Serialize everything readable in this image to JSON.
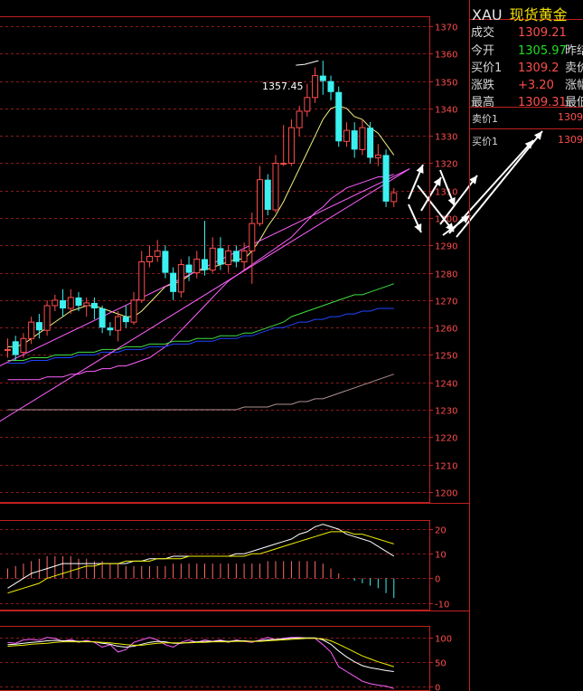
{
  "quote": {
    "symbol": "XAU",
    "name": "现货黄金",
    "rows": [
      {
        "label": "成交",
        "value": "1309.21",
        "value_color": "#ff4d4d",
        "label2": ""
      },
      {
        "label": "今开",
        "value": "1305.97",
        "value_color": "#22dd22",
        "label2": "昨结"
      },
      {
        "label": "买价1",
        "value": "1309.2",
        "value_color": "#ff4d4d",
        "label2": "卖价"
      },
      {
        "label": "涨跌",
        "value": "+3.20",
        "value_color": "#ff4d4d",
        "label2": "涨幅"
      },
      {
        "label": "最高",
        "value": "1309.31",
        "value_color": "#ff4d4d",
        "label2": "最低"
      }
    ],
    "order_book": [
      {
        "label": "卖价1",
        "value": "1309"
      },
      {
        "label": "买价1",
        "value": "1309"
      }
    ]
  },
  "chart_data": [
    {
      "type": "candlestick",
      "title": "",
      "y_ticks": [
        1200,
        1210,
        1220,
        1230,
        1240,
        1250,
        1260,
        1270,
        1280,
        1290,
        1300,
        1310,
        1320,
        1330,
        1340,
        1350,
        1360,
        1370
      ],
      "ylim": [
        1196,
        1373
      ],
      "annotation": {
        "text": "1357.45",
        "index": 40,
        "value": 1357.45
      },
      "colors": {
        "up": "#ff4d4d",
        "down": "#3cf0f0"
      },
      "candles": [
        [
          1252,
          1252,
          1256,
          1249
        ],
        [
          1255,
          1250,
          1257,
          1248
        ],
        [
          1251,
          1256,
          1258,
          1249
        ],
        [
          1256,
          1262,
          1264,
          1254
        ],
        [
          1262,
          1259,
          1265,
          1256
        ],
        [
          1259,
          1268,
          1270,
          1257
        ],
        [
          1268,
          1270,
          1272,
          1266
        ],
        [
          1270,
          1267,
          1274,
          1264
        ],
        [
          1267,
          1271,
          1274,
          1265
        ],
        [
          1271,
          1268,
          1273,
          1266
        ],
        [
          1268,
          1269,
          1271,
          1264
        ],
        [
          1269,
          1267,
          1271,
          1263
        ],
        [
          1267,
          1260,
          1268,
          1258
        ],
        [
          1260,
          1259,
          1262,
          1257
        ],
        [
          1259,
          1264,
          1266,
          1255
        ],
        [
          1264,
          1262,
          1268,
          1260
        ],
        [
          1262,
          1270,
          1273,
          1261
        ],
        [
          1270,
          1284,
          1288,
          1269
        ],
        [
          1284,
          1286,
          1290,
          1282
        ],
        [
          1286,
          1288,
          1292,
          1284
        ],
        [
          1288,
          1280,
          1290,
          1278
        ],
        [
          1280,
          1273,
          1282,
          1270
        ],
        [
          1273,
          1283,
          1285,
          1271
        ],
        [
          1283,
          1280,
          1286,
          1277
        ],
        [
          1280,
          1285,
          1288,
          1278
        ],
        [
          1285,
          1281,
          1299,
          1279
        ],
        [
          1281,
          1289,
          1293,
          1280
        ],
        [
          1289,
          1283,
          1293,
          1281
        ],
        [
          1283,
          1288,
          1290,
          1280
        ],
        [
          1288,
          1284,
          1290,
          1282
        ],
        [
          1284,
          1288,
          1291,
          1281
        ],
        [
          1288,
          1298,
          1302,
          1276
        ],
        [
          1298,
          1314,
          1319,
          1297
        ],
        [
          1314,
          1303,
          1316,
          1301
        ],
        [
          1303,
          1320,
          1323,
          1302
        ],
        [
          1320,
          1320,
          1334,
          1319
        ],
        [
          1320,
          1333,
          1336,
          1319
        ],
        [
          1333,
          1339,
          1341,
          1330
        ],
        [
          1339,
          1344,
          1349,
          1337
        ],
        [
          1344,
          1352,
          1355,
          1342
        ],
        [
          1352,
          1350,
          1357.45,
          1345
        ],
        [
          1350,
          1346,
          1352,
          1343
        ],
        [
          1346,
          1328,
          1348,
          1326
        ],
        [
          1328,
          1332,
          1335,
          1326
        ],
        [
          1332,
          1325,
          1335,
          1322
        ],
        [
          1325,
          1333,
          1336,
          1323
        ],
        [
          1333,
          1322,
          1335,
          1320
        ],
        [
          1322,
          1323,
          1327,
          1319
        ],
        [
          1323,
          1306,
          1325,
          1304
        ],
        [
          1306,
          1309.21,
          1311,
          1304
        ]
      ],
      "moving_averages": [
        {
          "color": "#f0f080",
          "values": [
            1253,
            1253,
            1254,
            1256,
            1258,
            1260,
            1262,
            1264,
            1266,
            1267,
            1268,
            1268,
            1267,
            1266,
            1265,
            1264,
            1264,
            1266,
            1269,
            1272,
            1275,
            1276,
            1277,
            1279,
            1281,
            1281,
            1282,
            1283,
            1284,
            1285,
            1285,
            1288,
            1292,
            1297,
            1301,
            1306,
            1312,
            1318,
            1324,
            1330,
            1336,
            1340,
            1341,
            1340,
            1337,
            1336,
            1333,
            1331,
            1327,
            1323
          ]
        },
        {
          "color": "#ff60ff",
          "values": [
            1241,
            1241,
            1241,
            1241,
            1241,
            1242,
            1242,
            1242,
            1243,
            1243,
            1244,
            1244,
            1245,
            1245,
            1246,
            1246,
            1247,
            1248,
            1249,
            1251,
            1253,
            1256,
            1259,
            1262,
            1265,
            1268,
            1271,
            1274,
            1277,
            1279,
            1281,
            1283,
            1285,
            1287,
            1289,
            1291,
            1293,
            1296,
            1299,
            1302,
            1304,
            1307,
            1309,
            1311,
            1312,
            1313,
            1314,
            1315,
            1315,
            1316
          ]
        },
        {
          "color": "#40e040",
          "values": [
            1248,
            1248,
            1248,
            1249,
            1249,
            1249,
            1250,
            1250,
            1250,
            1251,
            1251,
            1251,
            1252,
            1252,
            1252,
            1253,
            1253,
            1253,
            1254,
            1254,
            1254,
            1255,
            1255,
            1255,
            1256,
            1256,
            1256,
            1257,
            1257,
            1257,
            1258,
            1258,
            1259,
            1260,
            1261,
            1262,
            1264,
            1265,
            1266,
            1267,
            1268,
            1269,
            1270,
            1271,
            1272,
            1272,
            1273,
            1274,
            1275,
            1276
          ]
        },
        {
          "color": "#2244ff",
          "values": [
            1247,
            1247,
            1247,
            1248,
            1248,
            1248,
            1249,
            1249,
            1249,
            1250,
            1250,
            1250,
            1251,
            1251,
            1251,
            1252,
            1252,
            1252,
            1253,
            1253,
            1253,
            1254,
            1254,
            1254,
            1255,
            1255,
            1255,
            1256,
            1256,
            1256,
            1257,
            1257,
            1258,
            1259,
            1260,
            1260,
            1261,
            1262,
            1262,
            1263,
            1263,
            1264,
            1264,
            1265,
            1265,
            1266,
            1266,
            1267,
            1267,
            1267
          ]
        },
        {
          "color": "#b09090",
          "values": [
            1230,
            1230,
            1230,
            1230,
            1230,
            1230,
            1230,
            1230,
            1230,
            1230,
            1230,
            1230,
            1230,
            1230,
            1230,
            1230,
            1230,
            1230,
            1230,
            1230,
            1230,
            1230,
            1230,
            1230,
            1230,
            1230,
            1230,
            1230,
            1230,
            1230,
            1231,
            1231,
            1231,
            1231,
            1232,
            1232,
            1232,
            1233,
            1233,
            1234,
            1234,
            1235,
            1236,
            1237,
            1238,
            1239,
            1240,
            1241,
            1242,
            1243
          ]
        }
      ],
      "trendlines": [
        {
          "color": "#ff60ff",
          "from": [
            -2,
            1224
          ],
          "to": [
            51,
            1318
          ]
        },
        {
          "color": "#ff60ff",
          "from": [
            -1,
            1246
          ],
          "to": [
            51,
            1318
          ]
        }
      ]
    },
    {
      "type": "bar",
      "title": "",
      "y_ticks": [
        -10,
        0,
        10,
        20
      ],
      "ylim": [
        -12,
        23
      ],
      "colors": {
        "up": "#ff6a6a",
        "down": "#3cf0f0"
      },
      "values": [
        4,
        5,
        6,
        7,
        8,
        9,
        9,
        9,
        9,
        8,
        8,
        7,
        7,
        6,
        6,
        5,
        5,
        5,
        5,
        5,
        5,
        6,
        6,
        6,
        6,
        6,
        6,
        6,
        6,
        6,
        6,
        6,
        6,
        7,
        7,
        7,
        7,
        7,
        7,
        7,
        6,
        4,
        2,
        0,
        -1,
        -2,
        -3,
        -4,
        -6,
        -8
      ],
      "lines": [
        {
          "color": "#ffffff",
          "values": [
            -4,
            -2,
            0,
            2,
            3,
            4,
            5,
            6,
            6,
            6,
            6,
            6,
            6,
            6,
            6,
            6,
            7,
            7,
            8,
            8,
            8,
            9,
            9,
            9,
            9,
            9,
            9,
            9,
            9,
            10,
            10,
            11,
            12,
            13,
            14,
            15,
            16,
            18,
            19,
            21,
            22,
            21,
            20,
            18,
            17,
            16,
            15,
            13,
            11,
            9
          ]
        },
        {
          "color": "#f0f000",
          "values": [
            -6,
            -5,
            -4,
            -3,
            -2,
            0,
            1,
            2,
            3,
            4,
            5,
            5,
            6,
            6,
            6,
            7,
            7,
            7,
            7,
            8,
            8,
            8,
            8,
            9,
            9,
            9,
            9,
            9,
            9,
            9,
            9,
            10,
            10,
            11,
            12,
            13,
            14,
            15,
            16,
            17,
            18,
            19,
            19,
            19,
            18,
            18,
            17,
            16,
            15,
            14
          ]
        }
      ]
    },
    {
      "type": "line",
      "title": "",
      "y_ticks": [
        0,
        50,
        100
      ],
      "ylim": [
        -10,
        120
      ],
      "lines": [
        {
          "color": "#ff60ff",
          "values": [
            90,
            88,
            95,
            96,
            94,
            100,
            98,
            92,
            96,
            90,
            94,
            90,
            80,
            85,
            70,
            75,
            90,
            95,
            100,
            95,
            85,
            80,
            90,
            95,
            90,
            95,
            92,
            95,
            90,
            95,
            92,
            90,
            95,
            100,
            95,
            98,
            100,
            100,
            98,
            98,
            85,
            70,
            40,
            30,
            20,
            10,
            5,
            2,
            0,
            -5
          ]
        },
        {
          "color": "#ffffff",
          "values": [
            85,
            86,
            88,
            90,
            91,
            93,
            94,
            93,
            93,
            92,
            92,
            91,
            88,
            86,
            82,
            80,
            82,
            86,
            90,
            92,
            91,
            88,
            88,
            90,
            91,
            92,
            92,
            93,
            92,
            93,
            93,
            92,
            93,
            95,
            96,
            97,
            98,
            99,
            99,
            99,
            95,
            86,
            72,
            60,
            50,
            42,
            38,
            35,
            32,
            30
          ]
        },
        {
          "color": "#f0f000",
          "values": [
            82,
            83,
            84,
            86,
            87,
            88,
            90,
            91,
            91,
            91,
            91,
            91,
            90,
            89,
            87,
            85,
            84,
            84,
            86,
            88,
            89,
            89,
            89,
            89,
            90,
            90,
            91,
            91,
            91,
            92,
            92,
            92,
            92,
            93,
            94,
            95,
            96,
            97,
            98,
            98,
            97,
            93,
            86,
            78,
            70,
            62,
            56,
            50,
            45,
            40
          ]
        }
      ]
    }
  ]
}
